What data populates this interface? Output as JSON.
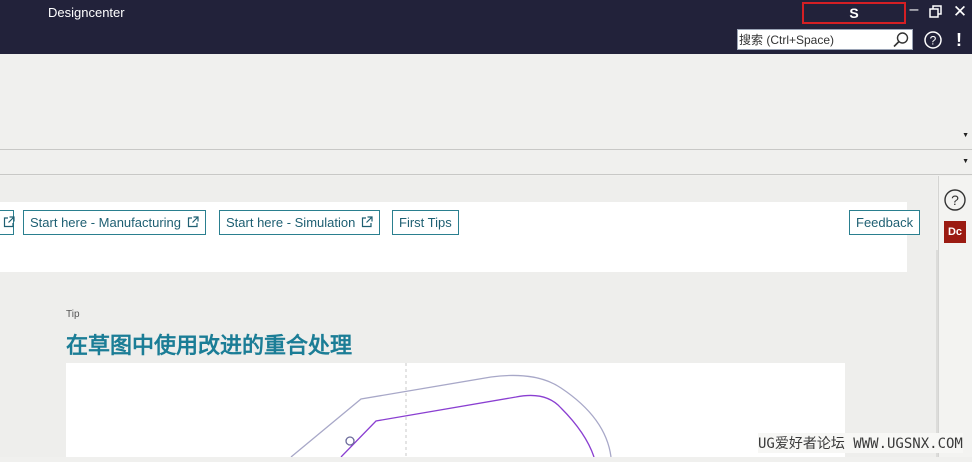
{
  "titlebar": {
    "app_title": "Designcenter",
    "s_label": "S",
    "minimize": "–",
    "restore": "🗗",
    "close": "✕",
    "info": "!"
  },
  "search": {
    "placeholder": "搜索 (Ctrl+Space)"
  },
  "toolbar": {
    "links": [
      {
        "label": "Start here - Manufacturing",
        "external": true
      },
      {
        "label": "Start here - Simulation",
        "external": true
      },
      {
        "label": "First Tips",
        "external": false
      }
    ],
    "feedback_label": "Feedback"
  },
  "tip": {
    "label": "Tip",
    "title": "在草图中使用改进的重合处理"
  },
  "sidebar": {
    "dc_label": "Dc"
  },
  "watermark": "UG爱好者论坛 WWW.UGSNX.COM",
  "colors": {
    "titlebar": "#22223a",
    "accent": "#1b7d96",
    "highlight_box": "#d41f24",
    "dc_icon": "#9b1b12"
  }
}
